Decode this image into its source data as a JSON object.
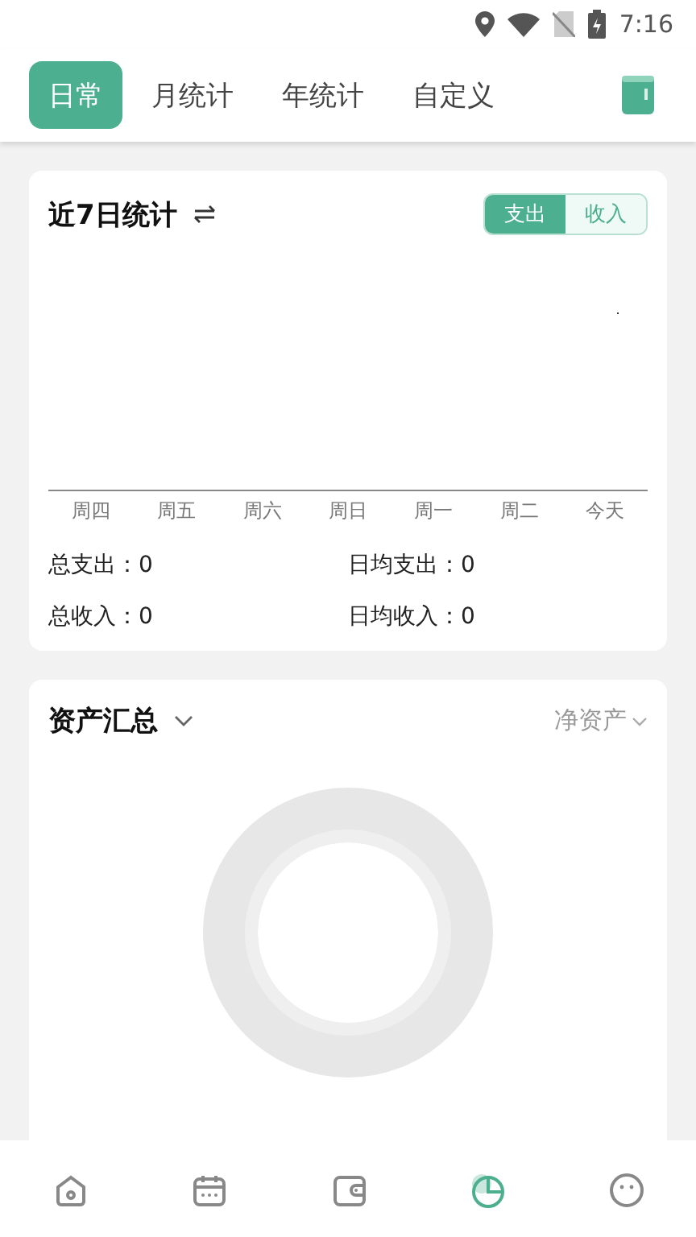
{
  "status_bar": {
    "time": "7:16"
  },
  "tabs": [
    {
      "label": "日常",
      "selected": true
    },
    {
      "label": "月统计",
      "selected": false
    },
    {
      "label": "年统计",
      "selected": false
    },
    {
      "label": "自定义",
      "selected": false
    }
  ],
  "recent_card": {
    "title": "近7日统计",
    "toggle": [
      {
        "label": "支出",
        "selected": true
      },
      {
        "label": "收入",
        "selected": false
      }
    ],
    "x_labels": [
      "周四",
      "周五",
      "周六",
      "周日",
      "周一",
      "周二",
      "今天"
    ],
    "stats": [
      {
        "label": "总支出：0"
      },
      {
        "label": "日均支出：0"
      },
      {
        "label": "总收入：0"
      },
      {
        "label": "日均收入：0"
      }
    ]
  },
  "asset_card": {
    "title": "资产汇总",
    "filter": "净资产"
  },
  "bottom_nav": [
    {
      "kind": "home",
      "selected": false
    },
    {
      "kind": "calendar",
      "selected": false
    },
    {
      "kind": "wallet",
      "selected": false
    },
    {
      "kind": "chart",
      "selected": true
    },
    {
      "kind": "face",
      "selected": false
    }
  ]
}
